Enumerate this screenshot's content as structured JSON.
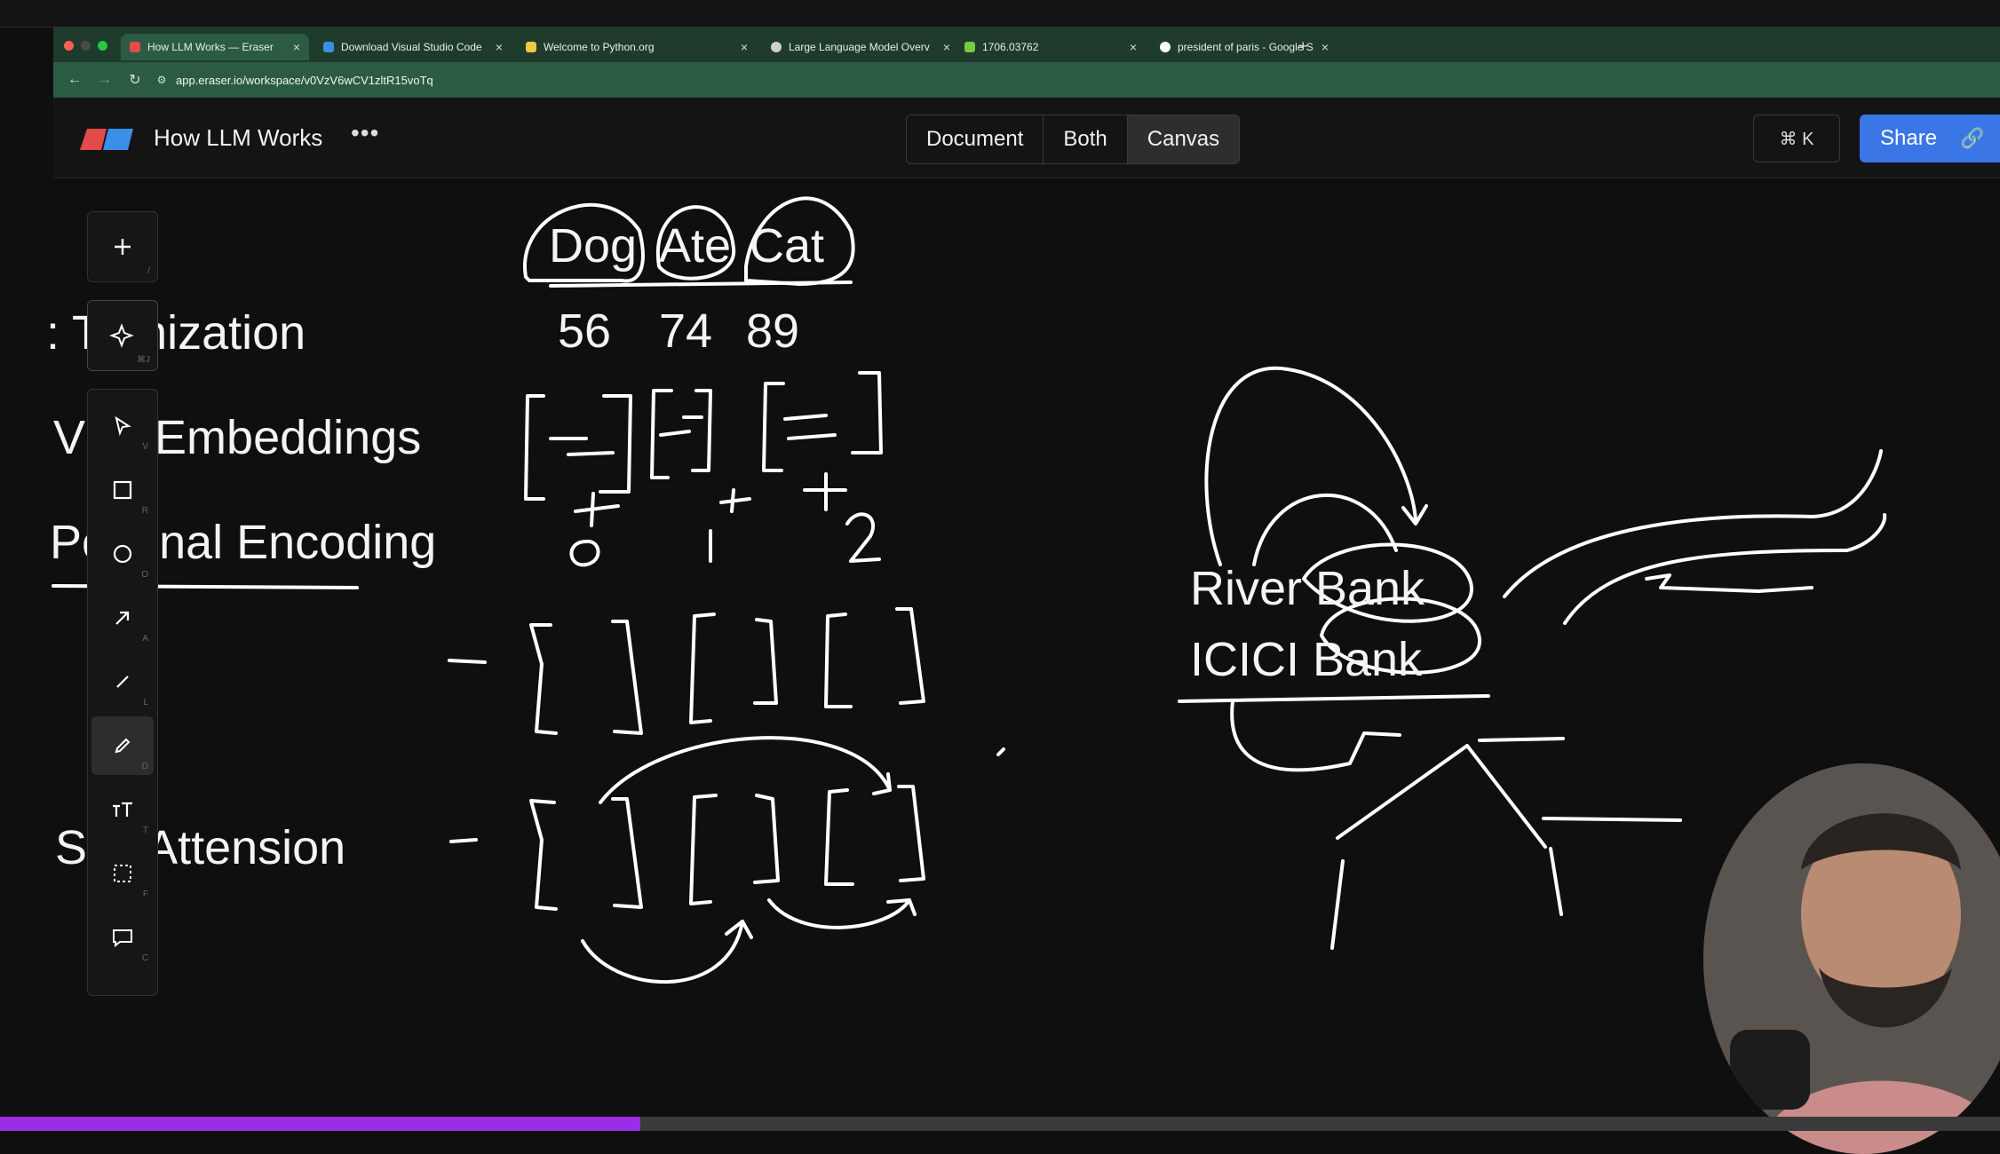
{
  "browser": {
    "tabs": [
      {
        "title": "How LLM Works — Eraser",
        "favicon_color": "#e34b4b",
        "active": true
      },
      {
        "title": "Download Visual Studio Code",
        "favicon_color": "#3b8fe6",
        "active": false
      },
      {
        "title": "Welcome to Python.org",
        "favicon_color": "#f2c744",
        "active": false
      },
      {
        "title": "Large Language Model Overv",
        "favicon_color": "#d0d0d0",
        "active": false
      },
      {
        "title": "1706.03762",
        "favicon_color": "#7ac943",
        "active": false
      },
      {
        "title": "president of paris - Google S",
        "favicon_color": "#ffffff",
        "active": false
      }
    ],
    "url": "app.eraser.io/workspace/v0VzV6wCV1zltR15voTq"
  },
  "app": {
    "title": "How LLM Works",
    "more_label": "•••",
    "view_modes": [
      "Document",
      "Both",
      "Canvas"
    ],
    "selected_view": "Canvas",
    "command_shortcut": "⌘ K",
    "share_label": "Share",
    "brand_colors": {
      "logo_red": "#e34b4b",
      "logo_blue": "#3b8fe6",
      "share_blue": "#3b76e6"
    }
  },
  "toolbar": {
    "add_key": "/",
    "ai_key": "⌘J",
    "tools": [
      {
        "name": "select",
        "key": "V"
      },
      {
        "name": "rectangle",
        "key": "R"
      },
      {
        "name": "ellipse",
        "key": "O"
      },
      {
        "name": "arrow",
        "key": "A"
      },
      {
        "name": "line",
        "key": "L"
      },
      {
        "name": "pencil",
        "key": "D",
        "active": true
      },
      {
        "name": "text",
        "key": "T"
      },
      {
        "name": "frame",
        "key": "F"
      },
      {
        "name": "comment",
        "key": "C"
      }
    ]
  },
  "canvas": {
    "labels": {
      "tokenization": ": T   enization",
      "vector_embeddings": "V      or Embeddings",
      "positional_encoding": "Po     ional Encoding",
      "self_attention": "Sell Attension"
    },
    "tokens": [
      "Dog",
      "Ate",
      "Cat"
    ],
    "token_ids": [
      "56",
      "74",
      "89"
    ],
    "words": [
      "River Bank",
      "ICICI Bank"
    ]
  },
  "video_progress": {
    "played_fraction": 0.32
  }
}
